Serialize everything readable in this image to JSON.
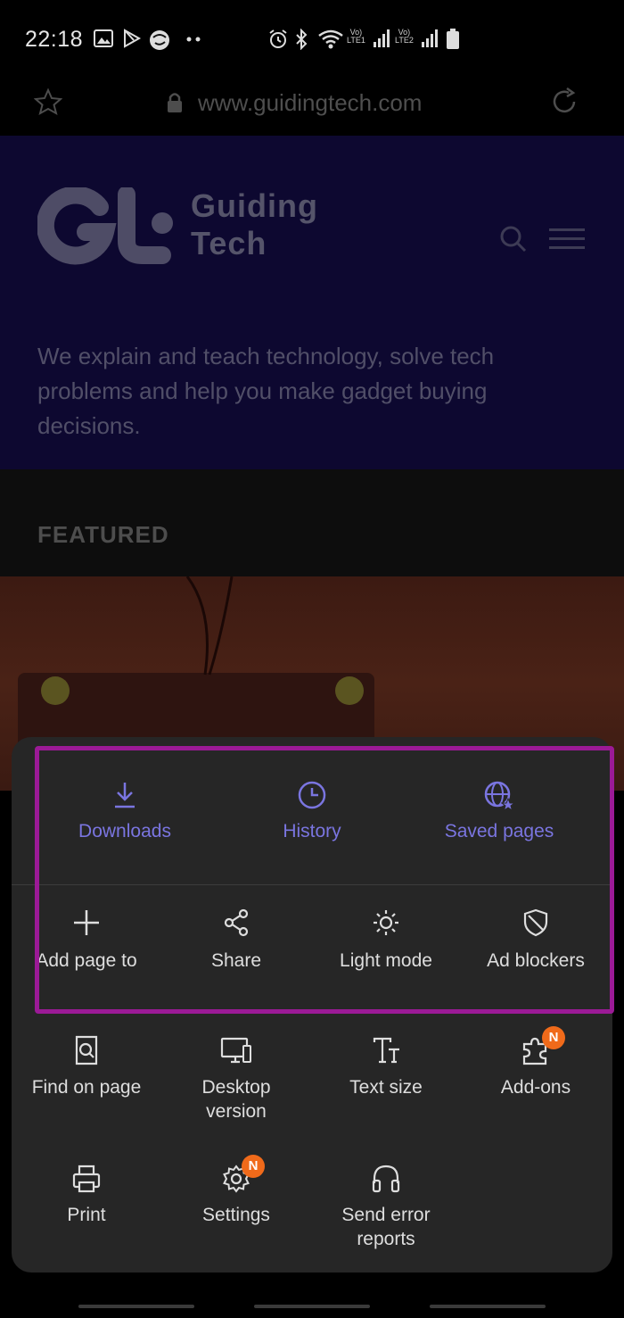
{
  "status_bar": {
    "time": "22:18",
    "sim1_label_top": "Vo)",
    "sim1_label_bottom": "LTE1",
    "sim2_label_top": "Vo)",
    "sim2_label_bottom": "LTE2"
  },
  "browser": {
    "url": "www.guidingtech.com"
  },
  "page": {
    "brand_line1": "Guiding",
    "brand_line2": "Tech",
    "tagline": "We explain and teach technology, solve tech problems and help you make gadget buying decisions.",
    "featured_heading": "FEATURED"
  },
  "menu": {
    "top_row": [
      {
        "label": "Downloads",
        "icon": "download-icon"
      },
      {
        "label": "History",
        "icon": "clock-icon"
      },
      {
        "label": "Saved pages",
        "icon": "globe-star-icon"
      }
    ],
    "row2": [
      {
        "label": "Add page to",
        "icon": "plus-icon"
      },
      {
        "label": "Share",
        "icon": "share-icon"
      },
      {
        "label": "Light mode",
        "icon": "sun-icon"
      },
      {
        "label": "Ad blockers",
        "icon": "shield-icon"
      }
    ],
    "row3": [
      {
        "label": "Find on page",
        "icon": "find-page-icon"
      },
      {
        "label": "Desktop version",
        "icon": "desktop-icon"
      },
      {
        "label": "Text size",
        "icon": "text-size-icon"
      },
      {
        "label": "Add-ons",
        "icon": "puzzle-icon",
        "badge": "N"
      }
    ],
    "row4": [
      {
        "label": "Print",
        "icon": "printer-icon"
      },
      {
        "label": "Settings",
        "icon": "gear-icon",
        "badge": "N"
      },
      {
        "label": "Send error reports",
        "icon": "headphones-icon"
      }
    ]
  },
  "colors": {
    "accent": "#7a75e0",
    "highlight_border": "#9b1a96",
    "badge": "#f06a1a",
    "sheet_bg": "#262626"
  }
}
